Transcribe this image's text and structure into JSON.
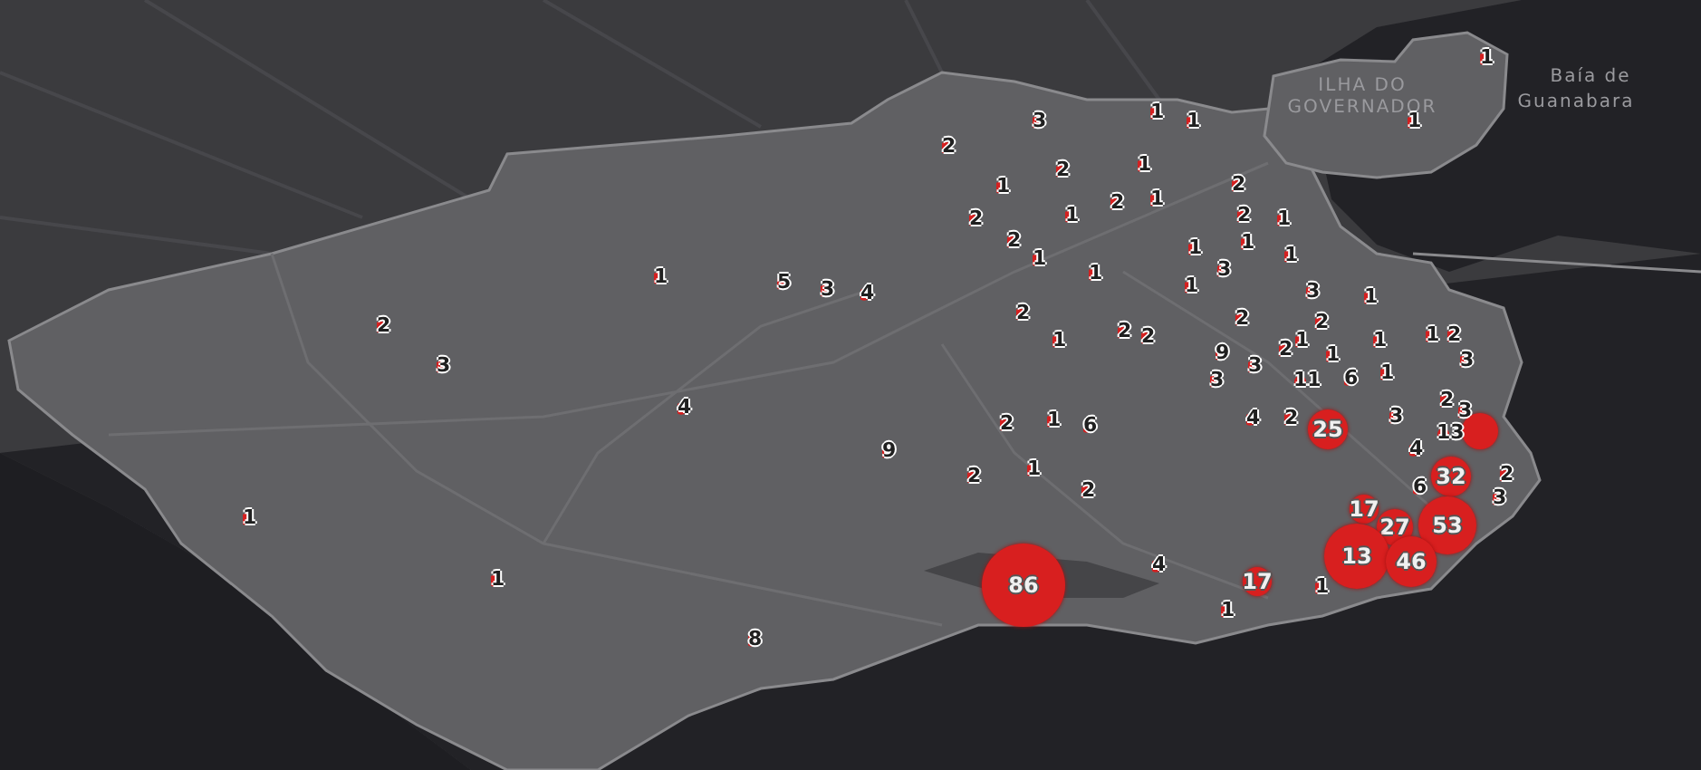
{
  "map": {
    "place_labels": [
      {
        "text": "ILHA DO"
      },
      {
        "text": "Baía de"
      },
      {
        "text": "GOVERNADOR"
      },
      {
        "text": "Guanabara"
      }
    ],
    "markers": [
      {
        "count": "3"
      },
      {
        "count": "1"
      },
      {
        "count": "1"
      },
      {
        "count": "2"
      },
      {
        "count": "2"
      },
      {
        "count": "1"
      },
      {
        "count": "1"
      },
      {
        "count": "2"
      },
      {
        "count": "2"
      },
      {
        "count": "1"
      },
      {
        "count": "2"
      },
      {
        "count": "1"
      },
      {
        "count": "2"
      },
      {
        "count": "1"
      },
      {
        "count": "2"
      },
      {
        "count": "1"
      },
      {
        "count": "1"
      },
      {
        "count": "1"
      },
      {
        "count": "1"
      },
      {
        "count": "1"
      },
      {
        "count": "3"
      },
      {
        "count": "1"
      },
      {
        "count": "3"
      },
      {
        "count": "1"
      },
      {
        "count": "2"
      },
      {
        "count": "2"
      },
      {
        "count": "1"
      },
      {
        "count": "2"
      },
      {
        "count": "2"
      },
      {
        "count": "2"
      },
      {
        "count": "2"
      },
      {
        "count": "1"
      },
      {
        "count": "1"
      },
      {
        "count": "1"
      },
      {
        "count": "2"
      },
      {
        "count": "9"
      },
      {
        "count": "3"
      },
      {
        "count": "1"
      },
      {
        "count": "3"
      },
      {
        "count": "3"
      },
      {
        "count": "11"
      },
      {
        "count": "6"
      },
      {
        "count": "1"
      },
      {
        "count": "2"
      },
      {
        "count": "3"
      },
      {
        "count": "13"
      },
      {
        "count": "4"
      },
      {
        "count": "2"
      },
      {
        "count": "25"
      },
      {
        "count": "3"
      },
      {
        "count": "4"
      },
      {
        "count": "2"
      },
      {
        "count": "1"
      },
      {
        "count": "6"
      },
      {
        "count": "9"
      },
      {
        "count": "2"
      },
      {
        "count": "1"
      },
      {
        "count": "2"
      },
      {
        "count": "32"
      },
      {
        "count": "2"
      },
      {
        "count": "6"
      },
      {
        "count": "3"
      },
      {
        "count": "17"
      },
      {
        "count": "27"
      },
      {
        "count": "53"
      },
      {
        "count": "13"
      },
      {
        "count": "46"
      },
      {
        "count": "86"
      },
      {
        "count": "4"
      },
      {
        "count": "17"
      },
      {
        "count": "1"
      },
      {
        "count": "1"
      },
      {
        "count": "1"
      },
      {
        "count": "1"
      },
      {
        "count": "8"
      },
      {
        "count": "2"
      },
      {
        "count": "3"
      },
      {
        "count": "4"
      },
      {
        "count": "1"
      },
      {
        "count": "5"
      },
      {
        "count": "3"
      },
      {
        "count": "4"
      },
      {
        "count": "1"
      },
      {
        "count": "1"
      }
    ]
  }
}
